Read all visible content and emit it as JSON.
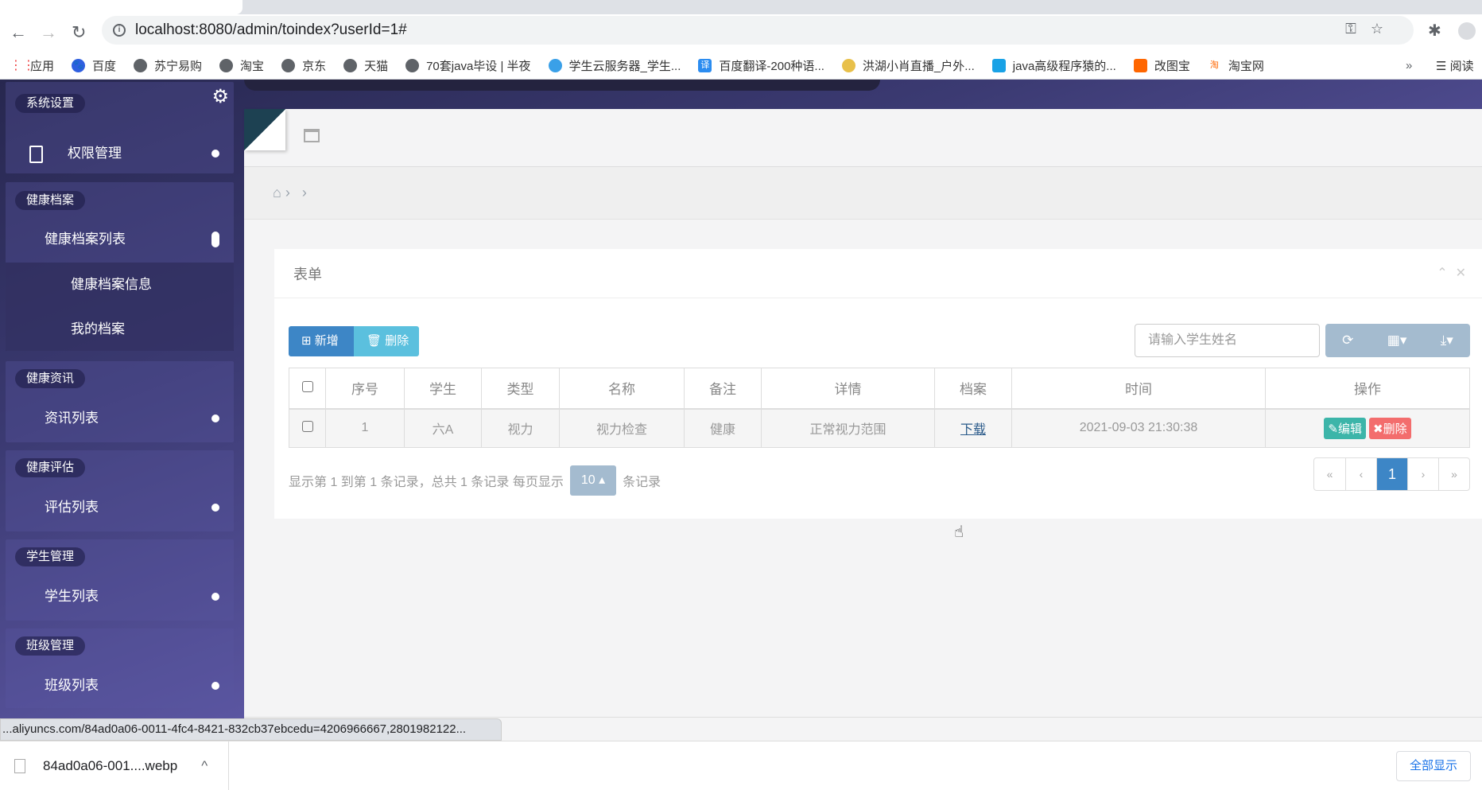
{
  "browser": {
    "url": "localhost:8080/admin/toindex?userId=1#",
    "bookmarks": [
      "应用",
      "百度",
      "苏宁易购",
      "淘宝",
      "京东",
      "天猫",
      "70套java毕设 | 半夜",
      "学生云服务器_学生...",
      "百度翻译-200种语...",
      "洪湖小肖直播_户外...",
      "java高级程序猿的...",
      "改图宝",
      "淘宝网"
    ],
    "more": "»",
    "reading_list": "阅读",
    "status_url": "...aliyuncs.com/84ad0a06-0011-4fc4-8421-832cb37ebcedu=4206966667,2801982122...",
    "download_file": "84ad0a06-001....webp",
    "show_all": "全部显示"
  },
  "sidebar": {
    "groups": [
      {
        "label": "系统设置",
        "items": [
          {
            "label": "权限管理"
          }
        ]
      },
      {
        "label": "健康档案",
        "items": [
          {
            "label": "健康档案列表",
            "children": [
              "健康档案信息",
              "我的档案"
            ]
          }
        ]
      },
      {
        "label": "健康资讯",
        "items": [
          {
            "label": "资讯列表"
          }
        ]
      },
      {
        "label": "健康评估",
        "items": [
          {
            "label": "评估列表"
          }
        ]
      },
      {
        "label": "学生管理",
        "items": [
          {
            "label": "学生列表"
          }
        ]
      },
      {
        "label": "班级管理",
        "items": [
          {
            "label": "班级列表"
          }
        ]
      }
    ]
  },
  "panel": {
    "title": "表单",
    "add": "新增",
    "delete": "删除",
    "search_placeholder": "请输入学生姓名",
    "columns": [
      "序号",
      "学生",
      "类型",
      "名称",
      "备注",
      "详情",
      "档案",
      "时间",
      "操作"
    ],
    "rows": [
      {
        "no": "1",
        "student": "六A",
        "type": "视力",
        "name": "视力检查",
        "remark": "健康",
        "detail": "正常视力范围",
        "file": "下载",
        "time": "2021-09-03 21:30:38",
        "edit": "编辑",
        "del": "删除"
      }
    ],
    "pagination": {
      "info": "显示第 1 到第 1 条记录，总共 1 条记录 每页显示",
      "page_size": "10",
      "suffix": "条记录",
      "first": "«",
      "prev": "‹",
      "current": "1",
      "next": "›",
      "last": "»"
    }
  },
  "colors": {
    "edit": "#3cb5a9",
    "del": "#f36d6d",
    "primary": "#3d86c6",
    "info": "#5bc0de"
  }
}
